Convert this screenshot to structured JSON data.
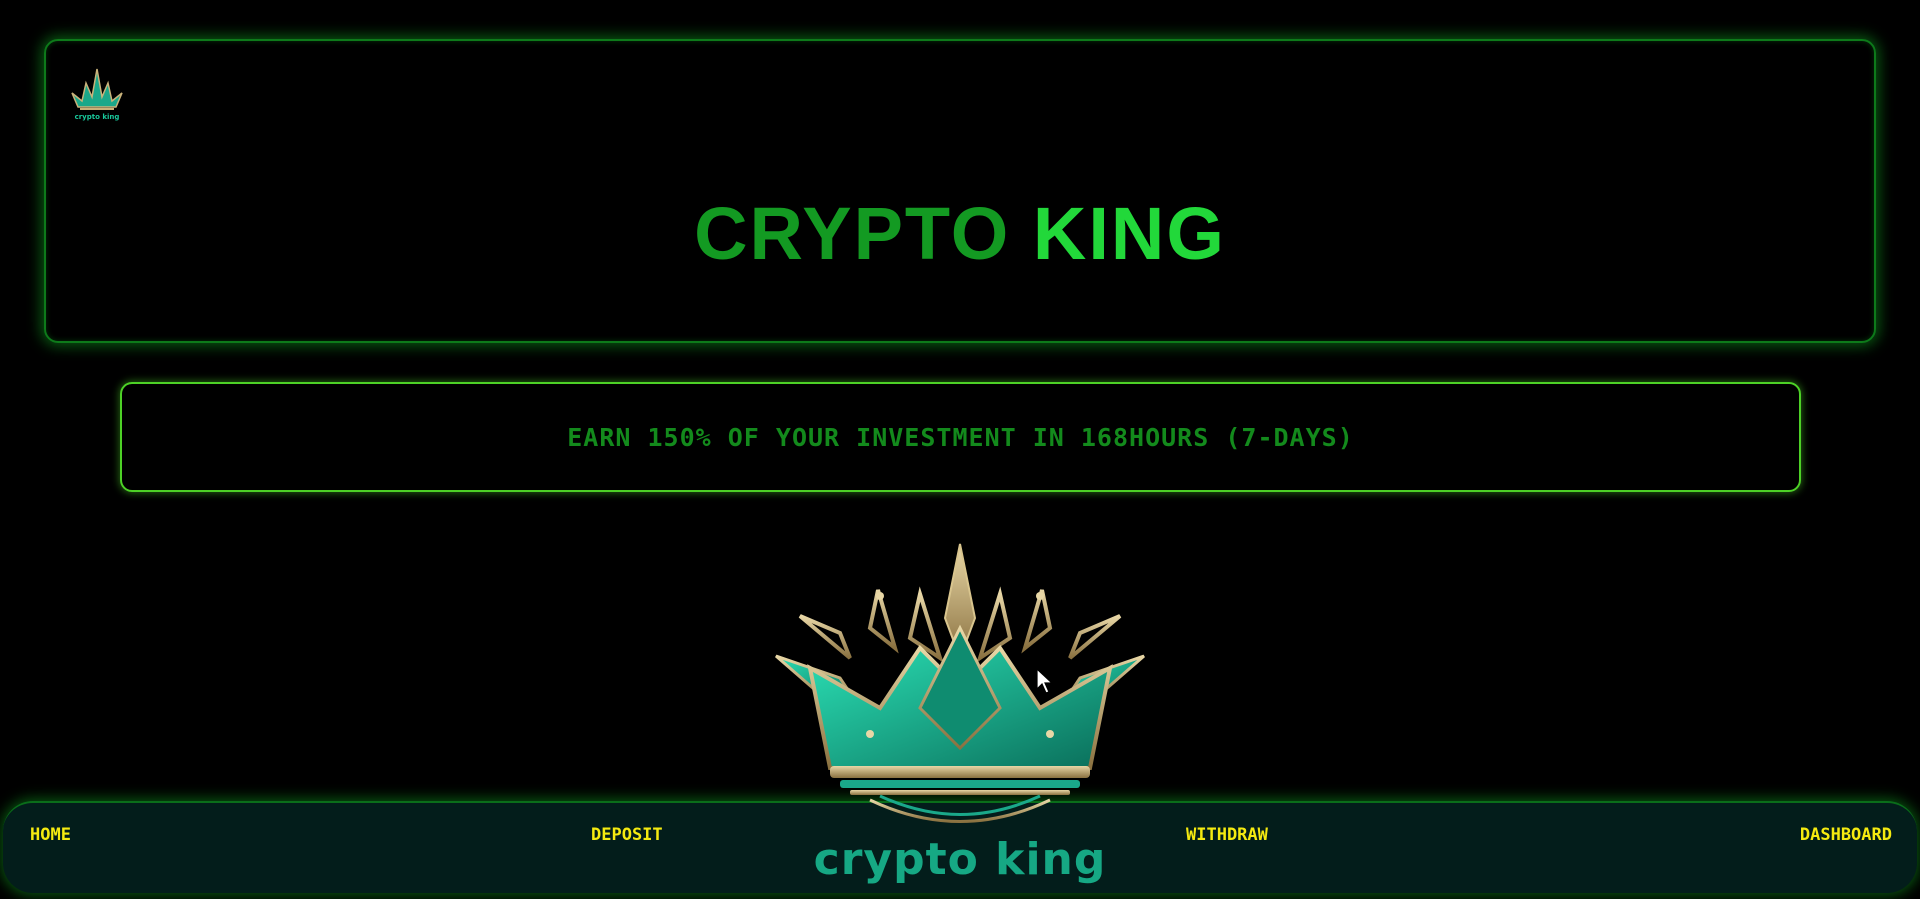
{
  "header": {
    "logo_small_text": "crypto king",
    "title_word1": "CRYPTO",
    "title_word2": "KING"
  },
  "banner": {
    "text": "EARN 150% OF YOUR INVESTMENT IN 168HOURS (7-DAYS)"
  },
  "hero": {
    "logo_text": "crypto king"
  },
  "nav": {
    "home": "HOME",
    "deposit": "DEPOSIT",
    "withdraw": "WITHDRAW",
    "dashboard": "DASHBOARD"
  },
  "colors": {
    "background": "#000000",
    "title_dark_green": "#139a22",
    "title_light_green": "#22d83a",
    "banner_text": "#138a1c",
    "nav_bg": "#031d1b",
    "nav_text": "#f5ea10",
    "brand_teal": "#16a884"
  }
}
